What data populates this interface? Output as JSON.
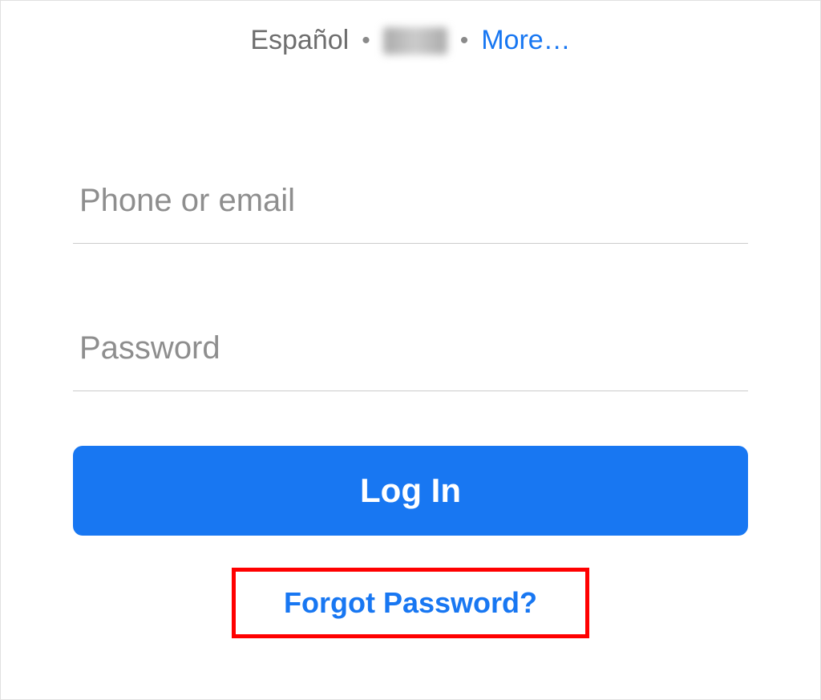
{
  "languageBar": {
    "item1": "Español",
    "separator": "•",
    "more": "More…"
  },
  "inputs": {
    "identifier_placeholder": "Phone or email",
    "password_placeholder": "Password"
  },
  "buttons": {
    "login": "Log In"
  },
  "links": {
    "forgot": "Forgot Password?"
  },
  "colors": {
    "primary": "#1877f2",
    "textMuted": "#6e6e6e",
    "highlightBorder": "#ff0000"
  }
}
